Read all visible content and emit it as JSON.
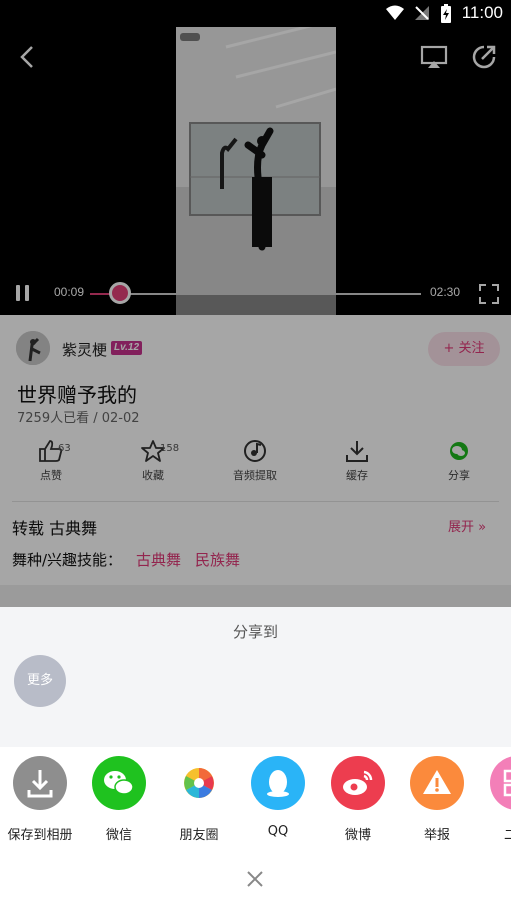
{
  "status_bar": {
    "time": "11:00"
  },
  "player": {
    "current_time": "00:09",
    "total_time": "02:30",
    "progress": 0.09,
    "video_caption": "世界赠予我的"
  },
  "author": {
    "name": "紫灵梗",
    "level": "Lv.12",
    "follow_label": "+ 关注"
  },
  "video": {
    "title": "世界赠予我的",
    "meta": "7259人已看 / 02-02"
  },
  "actions": [
    {
      "label": "点赞",
      "count": "63",
      "icon": "thumb-up-icon"
    },
    {
      "label": "收藏",
      "count": "158",
      "icon": "star-icon"
    },
    {
      "label": "音频提取",
      "count": "",
      "icon": "music-disc-icon"
    },
    {
      "label": "缓存",
      "count": "",
      "icon": "download-icon"
    },
    {
      "label": "分享",
      "count": "",
      "icon": "wechat-icon"
    }
  ],
  "details": {
    "repost": "转载 古典舞",
    "expand": "展开",
    "skills_label": "舞种/兴趣技能：",
    "skills": [
      "古典舞",
      "民族舞"
    ]
  },
  "share_sheet": {
    "title": "分享到",
    "more_label": "更多",
    "items": [
      {
        "label": "保存到相册",
        "color": "#8e8e8e"
      },
      {
        "label": "微信",
        "color": "#1fc21f"
      },
      {
        "label": "朋友圈",
        "color": "#ffffff"
      },
      {
        "label": "QQ",
        "color": "#2ab4f7"
      },
      {
        "label": "微博",
        "color": "#ed3d4f"
      },
      {
        "label": "举报",
        "color": "#fb8a3c"
      },
      {
        "label": "二维",
        "color": "#f37fb8"
      }
    ]
  },
  "colors": {
    "accent": "#e33f79",
    "level_badge": "#c8328e"
  }
}
